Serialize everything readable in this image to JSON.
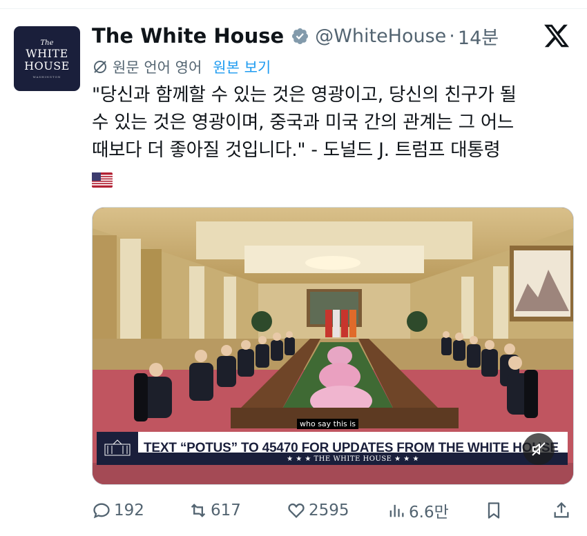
{
  "avatar": {
    "line1": "The",
    "line2": "WHITE",
    "line3": "HOUSE",
    "line4": "WASHINGTON"
  },
  "header": {
    "name": "The White House",
    "handle": "@WhiteHouse",
    "separator": "·",
    "time": "14분"
  },
  "translation": {
    "label": "원문 언어 영어",
    "show_original": "원본 보기"
  },
  "tweet": {
    "lines": [
      "\"당신과 함께할 수 있는 것은 영광이고, 당신의 친구가 될",
      "수 있는 것은 영광이며, 중국과 미국 간의 관계는 그 어느",
      "때보다 더 좋아질 것입니다.\" - 도널드 J. 트럼프 대통령"
    ],
    "flag_emoji": "🇺🇸"
  },
  "media": {
    "subtitle": "who say this is",
    "banner_text": "TEXT “POTUS” TO 45470 FOR UPDATES FROM THE WHITE HOUSE",
    "banner_sub": "★ ★ ★  THE WHITE HOUSE  ★ ★ ★"
  },
  "actions": {
    "replies": "192",
    "reposts": "617",
    "likes": "2595",
    "views": "6.6만"
  },
  "icons": [
    "verified-badge-icon",
    "x-logo-icon",
    "translate-icon",
    "reply-icon",
    "repost-icon",
    "like-icon",
    "views-icon",
    "bookmark-icon",
    "share-icon",
    "mute-icon"
  ],
  "colors": {
    "link": "#1d9bf0",
    "muted": "#536471",
    "navy": "#1a1f3b"
  }
}
